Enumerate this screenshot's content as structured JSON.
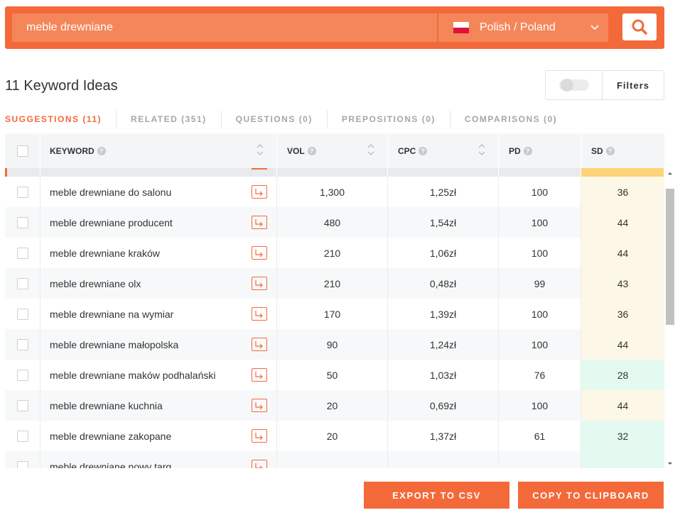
{
  "search": {
    "value": "meble drewniane",
    "locale_label": "Polish / Poland"
  },
  "colors": {
    "accent": "#f4693a",
    "sd_easy": "#e4faf1",
    "sd_medium": "#fdf7e8",
    "sd_band": "#fdd478"
  },
  "header": {
    "title": "11 Keyword Ideas",
    "filters_label": "Filters"
  },
  "tabs": [
    {
      "label": "SUGGESTIONS (11)"
    },
    {
      "label": "RELATED (351)"
    },
    {
      "label": "QUESTIONS (0)"
    },
    {
      "label": "PREPOSITIONS (0)"
    },
    {
      "label": "COMPARISONS (0)"
    }
  ],
  "columns": {
    "keyword": "KEYWORD",
    "vol": "VOL",
    "cpc": "CPC",
    "pd": "PD",
    "sd": "SD"
  },
  "rows": [
    {
      "keyword": "meble drewniane do salonu",
      "vol": "1,300",
      "cpc": "1,25zł",
      "pd": "100",
      "sd": "36",
      "sd_level": "medium"
    },
    {
      "keyword": "meble drewniane producent",
      "vol": "480",
      "cpc": "1,54zł",
      "pd": "100",
      "sd": "44",
      "sd_level": "medium"
    },
    {
      "keyword": "meble drewniane kraków",
      "vol": "210",
      "cpc": "1,06zł",
      "pd": "100",
      "sd": "44",
      "sd_level": "medium"
    },
    {
      "keyword": "meble drewniane olx",
      "vol": "210",
      "cpc": "0,48zł",
      "pd": "99",
      "sd": "43",
      "sd_level": "medium"
    },
    {
      "keyword": "meble drewniane na wymiar",
      "vol": "170",
      "cpc": "1,39zł",
      "pd": "100",
      "sd": "36",
      "sd_level": "medium"
    },
    {
      "keyword": "meble drewniane małopolska",
      "vol": "90",
      "cpc": "1,24zł",
      "pd": "100",
      "sd": "44",
      "sd_level": "medium"
    },
    {
      "keyword": "meble drewniane maków podhalański",
      "vol": "50",
      "cpc": "1,03zł",
      "pd": "76",
      "sd": "28",
      "sd_level": "easy"
    },
    {
      "keyword": "meble drewniane kuchnia",
      "vol": "20",
      "cpc": "0,69zł",
      "pd": "100",
      "sd": "44",
      "sd_level": "medium"
    },
    {
      "keyword": "meble drewniane zakopane",
      "vol": "20",
      "cpc": "1,37zł",
      "pd": "61",
      "sd": "32",
      "sd_level": "easy"
    },
    {
      "keyword": "meble drewniane nowy targ",
      "vol": "",
      "cpc": "",
      "pd": "",
      "sd": "",
      "sd_level": "easy"
    }
  ],
  "actions": {
    "export_label": "EXPORT TO CSV",
    "copy_label": "COPY TO CLIPBOARD"
  }
}
